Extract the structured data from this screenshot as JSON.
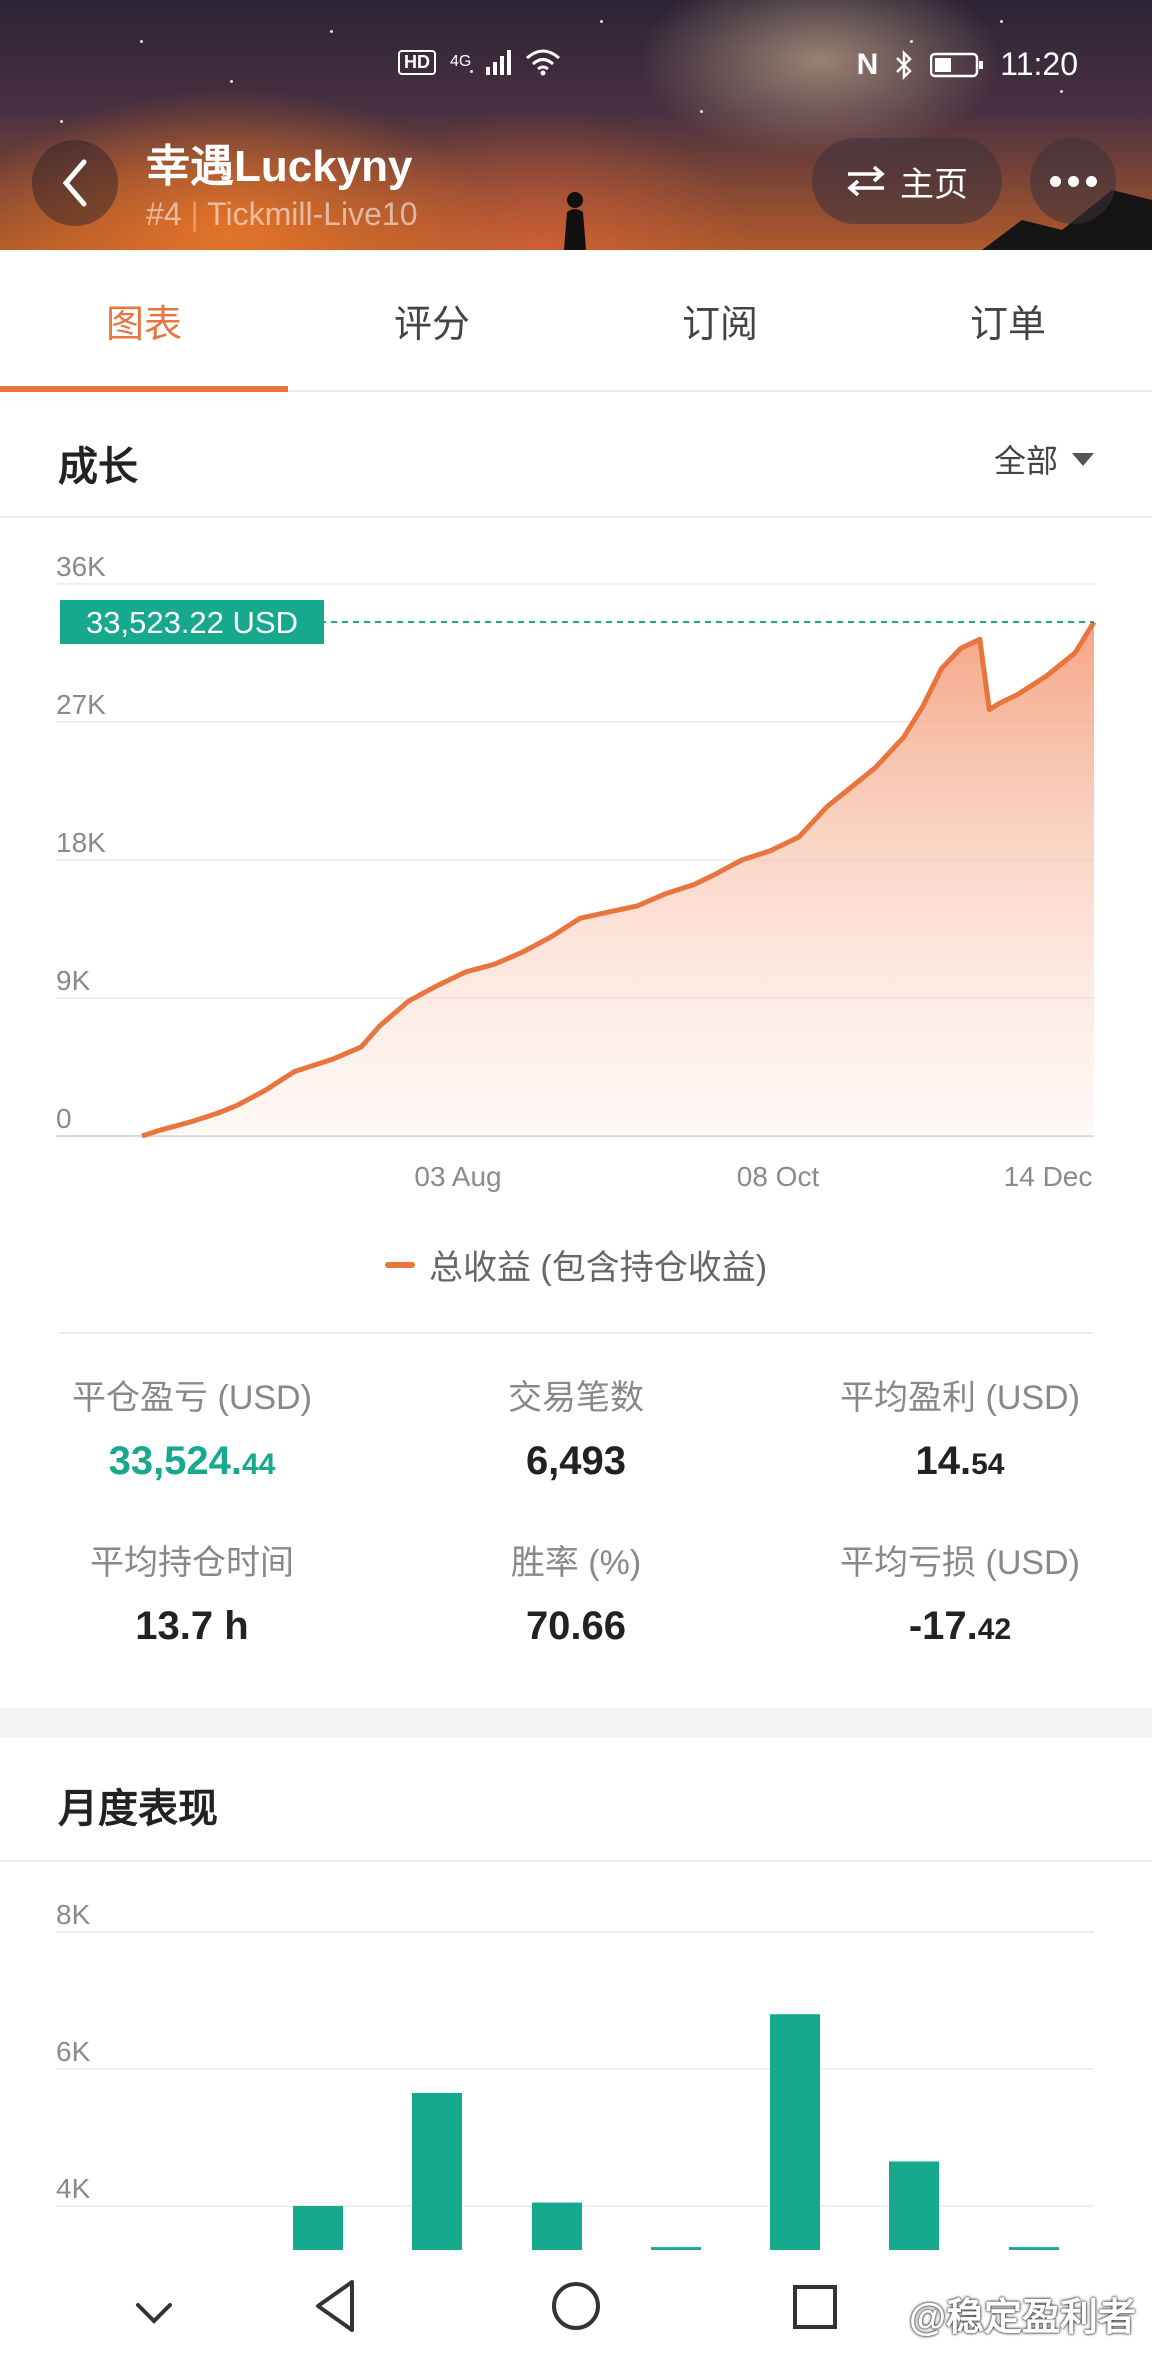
{
  "status_bar": {
    "hd": "HD",
    "network": "4G",
    "nfc": "N",
    "time": "11:20"
  },
  "header": {
    "name": "幸遇Luckyny",
    "rank": "#4",
    "server": "Tickmill-Live10",
    "home_label": "主页"
  },
  "tabs": [
    {
      "label": "图表",
      "active": true
    },
    {
      "label": "评分",
      "active": false
    },
    {
      "label": "订阅",
      "active": false
    },
    {
      "label": "订单",
      "active": false
    }
  ],
  "growth": {
    "title": "成长",
    "range": "全部",
    "legend": "总收益 (包含持仓收益)"
  },
  "chart_data": [
    {
      "type": "area",
      "title": "成长",
      "y_ticks": [
        "36K",
        "27K",
        "18K",
        "9K",
        "0"
      ],
      "x_ticks": [
        "03 Aug",
        "08 Oct",
        "14 Dec"
      ],
      "ylim": [
        0,
        36000
      ],
      "current_value_label": "33,523.22 USD",
      "current_value": 33523.22,
      "series": [
        {
          "name": "总收益 (包含持仓收益)",
          "color": "#e8753e",
          "x": [
            0,
            0.02,
            0.05,
            0.08,
            0.1,
            0.13,
            0.16,
            0.2,
            0.23,
            0.25,
            0.28,
            0.31,
            0.34,
            0.37,
            0.4,
            0.43,
            0.46,
            0.49,
            0.52,
            0.55,
            0.58,
            0.6,
            0.63,
            0.66,
            0.69,
            0.72,
            0.74,
            0.77,
            0.8,
            0.82,
            0.84,
            0.86,
            0.88,
            0.89,
            0.9,
            0.92,
            0.95,
            0.98,
            1.0
          ],
          "values": [
            0,
            400,
            900,
            1500,
            2000,
            3000,
            4200,
            5000,
            5800,
            7200,
            8800,
            9800,
            10700,
            11200,
            12000,
            13000,
            14200,
            14600,
            15000,
            15800,
            16400,
            17000,
            18000,
            18600,
            19500,
            21500,
            22500,
            24000,
            26000,
            28000,
            30500,
            31800,
            32400,
            27800,
            28200,
            28800,
            30000,
            31500,
            33523
          ]
        }
      ]
    },
    {
      "type": "bar",
      "title": "月度表现",
      "y_ticks": [
        "8K",
        "6K",
        "4K"
      ],
      "ylim": [
        2800,
        8000
      ],
      "color": "#16a98e",
      "values": [
        4000,
        5650,
        4050,
        3400,
        6800,
        4650,
        3400
      ]
    }
  ],
  "stats": [
    {
      "label": "平仓盈亏 (USD)",
      "main": "33,524.",
      "decimal": "44",
      "green": true
    },
    {
      "label": "交易笔数",
      "main": "6,493",
      "decimal": "",
      "green": false
    },
    {
      "label": "平均盈利 (USD)",
      "main": "14.",
      "decimal": "54",
      "green": false
    },
    {
      "label": "平均持仓时间",
      "main": "13.7 h",
      "decimal": "",
      "green": false
    },
    {
      "label": "胜率 (%)",
      "main": "70.66",
      "decimal": "",
      "green": false
    },
    {
      "label": "平均亏损 (USD)",
      "main": "-17.",
      "decimal": "42",
      "green": false
    }
  ],
  "monthly": {
    "title": "月度表现"
  },
  "watermark": "@稳定盈利者"
}
